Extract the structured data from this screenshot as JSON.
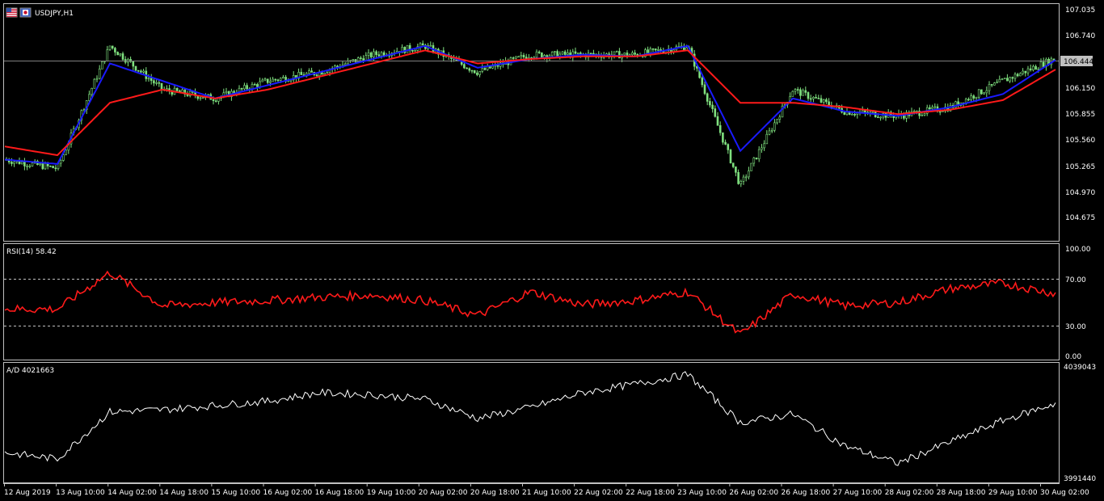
{
  "window": {
    "symbol_label": "USDJPY,H1",
    "flag_icons": [
      "us-flag-icon",
      "jp-flag-icon"
    ]
  },
  "colors": {
    "background": "#000000",
    "frame": "#c0c0c0",
    "candle": "#7fe07f",
    "ma_fast": "#1a1aff",
    "ma_slow": "#ff1a1a",
    "rsi": "#ff1a1a",
    "ad": "#ffffff",
    "current_price_box": "#c0c0c0"
  },
  "main_panel": {
    "y_ticks": [
      "107.035",
      "106.740",
      "106.150",
      "105.855",
      "105.560",
      "105.265",
      "104.970",
      "104.675"
    ],
    "current_price": "106.444"
  },
  "rsi_panel": {
    "label": "RSI(14) 58.42",
    "y_ticks": [
      "100.00",
      "70.00",
      "30.00",
      "0.00"
    ]
  },
  "ad_panel": {
    "label": "A/D 4021663",
    "y_ticks": [
      "4039043",
      "3991440"
    ]
  },
  "x_axis": {
    "labels": [
      "12 Aug 2019",
      "13 Aug 10:00",
      "14 Aug 02:00",
      "14 Aug 18:00",
      "15 Aug 10:00",
      "16 Aug 02:00",
      "16 Aug 18:00",
      "19 Aug 10:00",
      "20 Aug 02:00",
      "20 Aug 18:00",
      "21 Aug 10:00",
      "22 Aug 02:00",
      "22 Aug 18:00",
      "23 Aug 10:00",
      "26 Aug 02:00",
      "26 Aug 18:00",
      "27 Aug 10:00",
      "28 Aug 02:00",
      "28 Aug 18:00",
      "29 Aug 10:00",
      "30 Aug 02:00"
    ]
  },
  "chart_data": [
    {
      "type": "line",
      "title": "USDJPY,H1",
      "ylim": [
        104.38,
        107.07
      ],
      "x": [
        "12 Aug 2019",
        "13 Aug 10:00",
        "14 Aug 02:00",
        "14 Aug 18:00",
        "15 Aug 10:00",
        "16 Aug 02:00",
        "16 Aug 18:00",
        "19 Aug 10:00",
        "20 Aug 02:00",
        "20 Aug 18:00",
        "21 Aug 10:00",
        "22 Aug 02:00",
        "22 Aug 18:00",
        "23 Aug 10:00",
        "26 Aug 02:00",
        "26 Aug 18:00",
        "27 Aug 10:00",
        "28 Aug 02:00",
        "28 Aug 18:00",
        "29 Aug 10:00",
        "30 Aug 02:00"
      ],
      "series": [
        {
          "values": [
            105.3,
            105.2,
            106.6,
            106.1,
            106.0,
            106.2,
            106.3,
            106.5,
            106.6,
            106.3,
            106.5,
            106.5,
            106.5,
            106.6,
            105.0,
            106.1,
            105.85,
            105.8,
            105.9,
            106.2,
            106.46
          ]
        },
        {
          "values": [
            105.3,
            105.25,
            106.4,
            106.2,
            106.0,
            106.15,
            106.3,
            106.45,
            106.6,
            106.35,
            106.45,
            106.5,
            106.48,
            106.6,
            105.4,
            106.0,
            105.85,
            105.8,
            105.9,
            106.05,
            106.44
          ]
        },
        {
          "values": [
            105.45,
            105.35,
            105.95,
            106.1,
            106.0,
            106.1,
            106.25,
            106.4,
            106.55,
            106.4,
            106.45,
            106.48,
            106.48,
            106.55,
            105.95,
            105.95,
            105.9,
            105.82,
            105.87,
            105.98,
            106.33
          ]
        }
      ]
    },
    {
      "type": "line",
      "title": "RSI(14) 58.42",
      "ylim": [
        0,
        100
      ],
      "x": [
        "12 Aug 2019",
        "13 Aug 10:00",
        "14 Aug 02:00",
        "14 Aug 18:00",
        "15 Aug 10:00",
        "16 Aug 02:00",
        "16 Aug 18:00",
        "19 Aug 10:00",
        "20 Aug 02:00",
        "20 Aug 18:00",
        "21 Aug 10:00",
        "22 Aug 02:00",
        "22 Aug 18:00",
        "23 Aug 10:00",
        "26 Aug 02:00",
        "26 Aug 18:00",
        "27 Aug 10:00",
        "28 Aug 02:00",
        "28 Aug 18:00",
        "29 Aug 10:00",
        "30 Aug 02:00"
      ],
      "values": [
        44,
        44,
        78,
        47,
        50,
        52,
        55,
        57,
        52,
        38,
        60,
        48,
        52,
        60,
        20,
        58,
        47,
        50,
        63,
        68,
        58.42
      ]
    },
    {
      "type": "line",
      "title": "A/D 4021663",
      "ylim": [
        3991440,
        4039043
      ],
      "x": [
        "12 Aug 2019",
        "13 Aug 10:00",
        "14 Aug 02:00",
        "14 Aug 18:00",
        "15 Aug 10:00",
        "16 Aug 02:00",
        "16 Aug 18:00",
        "19 Aug 10:00",
        "20 Aug 02:00",
        "20 Aug 18:00",
        "21 Aug 10:00",
        "22 Aug 02:00",
        "22 Aug 18:00",
        "23 Aug 10:00",
        "26 Aug 02:00",
        "26 Aug 18:00",
        "27 Aug 10:00",
        "28 Aug 02:00",
        "28 Aug 18:00",
        "29 Aug 10:00",
        "30 Aug 02:00"
      ],
      "values": [
        4002000,
        3999000,
        4021000,
        4022000,
        4024000,
        4026000,
        4030000,
        4029000,
        4027000,
        4018000,
        4023000,
        4030000,
        4034000,
        4038500,
        4016000,
        4020000,
        4005000,
        3997000,
        4007000,
        4017000,
        4025000
      ]
    }
  ]
}
